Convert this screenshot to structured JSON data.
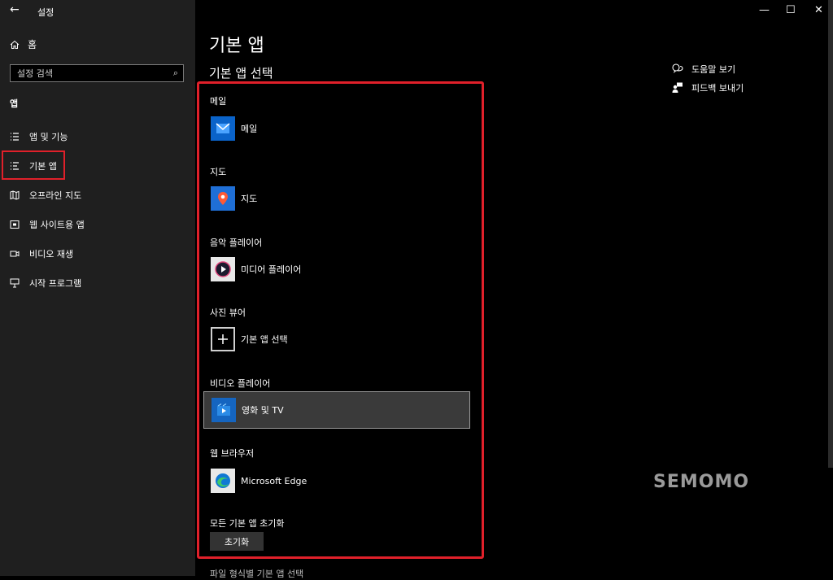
{
  "window": {
    "title": "설정",
    "back_icon": "←",
    "minimize_icon": "—",
    "maximize_icon": "☐",
    "close_icon": "✕"
  },
  "sidebar": {
    "home_label": "홈",
    "search_placeholder": "설정 검색",
    "section_label": "앱",
    "items": [
      {
        "label": "앱 및 기능",
        "icon": "apps-list-icon"
      },
      {
        "label": "기본 앱",
        "icon": "default-apps-icon"
      },
      {
        "label": "오프라인 지도",
        "icon": "offline-map-icon"
      },
      {
        "label": "웹 사이트용 앱",
        "icon": "website-app-icon"
      },
      {
        "label": "비디오 재생",
        "icon": "video-icon"
      },
      {
        "label": "시작 프로그램",
        "icon": "startup-icon"
      }
    ]
  },
  "main": {
    "title": "기본 앱",
    "subtitle": "기본 앱 선택",
    "categories": [
      {
        "label": "메일",
        "app": "메일"
      },
      {
        "label": "지도",
        "app": "지도"
      },
      {
        "label": "음악 플레이어",
        "app": "미디어 플레이어"
      },
      {
        "label": "사진 뷰어",
        "app": "기본 앱 선택"
      },
      {
        "label": "비디오 플레이어",
        "app": "영화 및 TV"
      },
      {
        "label": "웹 브라우저",
        "app": "Microsoft Edge"
      }
    ],
    "reset_label": "모든 기본 앱 초기화",
    "reset_button": "초기화",
    "cut_off_text": "파일 형식별 기본 앱 선택"
  },
  "links": {
    "help": "도움말 보기",
    "feedback": "피드백 보내기"
  },
  "watermark": "SEMOMO",
  "colors": {
    "highlight": "#e0202a",
    "mail_blue": "#0a63c9",
    "maps_blue": "#1f6fd6"
  }
}
